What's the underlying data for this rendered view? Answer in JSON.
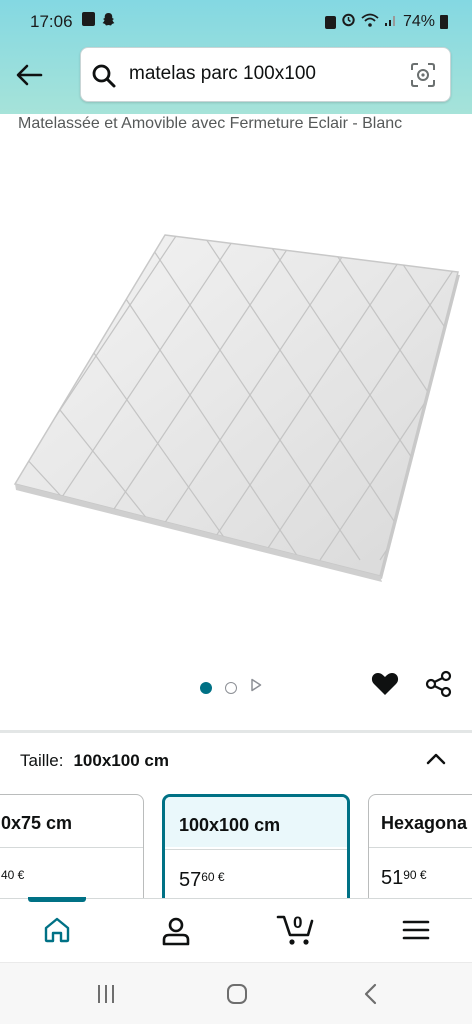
{
  "status_bar": {
    "time": "17:06",
    "battery": "74%"
  },
  "search": {
    "query": "matelas parc 100x100"
  },
  "product": {
    "title_fragment": "Matelassée et Amovible avec Fermeture Eclair - Blanc"
  },
  "gallery": {
    "image_alt": "white quilted square playpen mattress",
    "page_count": 2,
    "active_index": 0
  },
  "size_selector": {
    "label": "Taille:",
    "selected_value": "100x100 cm",
    "options": [
      {
        "name": "0x75 cm",
        "price_int": "",
        "price_dec": "40 €"
      },
      {
        "name": "100x100 cm",
        "price_int": "57",
        "price_dec": "60 €"
      },
      {
        "name": "Hexagona",
        "price_int": "51",
        "price_dec": "90 €"
      }
    ]
  },
  "bottom_nav": {
    "cart_count": "0"
  },
  "colors": {
    "accent": "#007185",
    "header_gradient_start": "#84d8e2",
    "header_gradient_end": "#a6e3d9"
  }
}
